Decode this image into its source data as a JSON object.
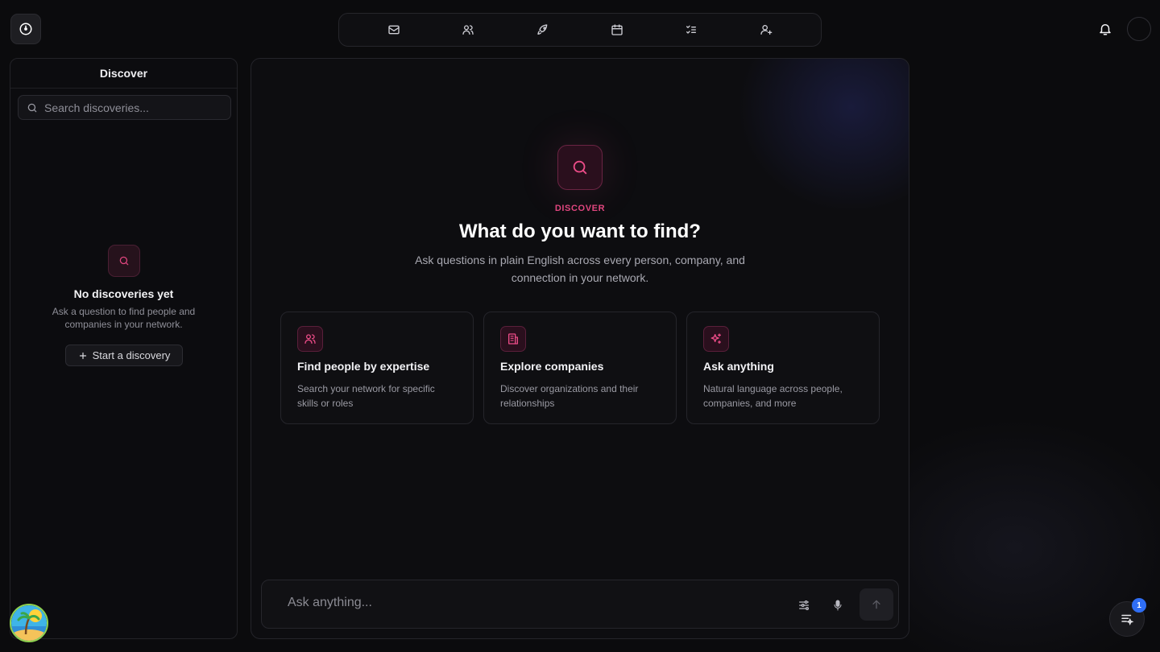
{
  "nav": {
    "items": [
      {
        "icon": "mail-icon"
      },
      {
        "icon": "users-icon"
      },
      {
        "icon": "rocket-icon"
      },
      {
        "icon": "calendar-icon"
      },
      {
        "icon": "checklist-icon"
      },
      {
        "icon": "user-plus-icon"
      }
    ]
  },
  "sidebar": {
    "title": "Discover",
    "search_placeholder": "Search discoveries...",
    "empty_title": "No discoveries yet",
    "empty_desc": "Ask a question to find people and companies in your network.",
    "start_label": "Start a discovery"
  },
  "main": {
    "eyebrow": "DISCOVER",
    "headline": "What do you want to find?",
    "subline": "Ask questions in plain English across every person, company, and connection in your network.",
    "cards": [
      {
        "icon": "users-icon",
        "title": "Find people by expertise",
        "desc": "Search your network for specific skills or roles"
      },
      {
        "icon": "building-icon",
        "title": "Explore companies",
        "desc": "Discover organizations and their relationships"
      },
      {
        "icon": "sparkles-icon",
        "title": "Ask anything",
        "desc": "Natural language across people, companies, and more"
      }
    ],
    "chat_placeholder": "Ask anything..."
  },
  "notifications": {
    "badge_count": "1"
  },
  "colors": {
    "accent": "#e0467f",
    "background": "#0b0b0d",
    "badge": "#2f6ef5"
  }
}
